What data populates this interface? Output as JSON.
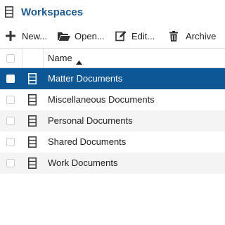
{
  "header": {
    "title": "Workspaces",
    "icon": "cabinet-icon"
  },
  "toolbar": {
    "new_label": "New...",
    "open_label": "Open...",
    "edit_label": "Edit...",
    "archive_label": "Archive"
  },
  "grid": {
    "column_name": "Name",
    "sort": "ascending",
    "rows": [
      {
        "name": "Matter Documents",
        "selected": true
      },
      {
        "name": "Miscellaneous Documents",
        "selected": false
      },
      {
        "name": "Personal Documents",
        "selected": false
      },
      {
        "name": "Shared Documents",
        "selected": false
      },
      {
        "name": "Work Documents",
        "selected": false
      }
    ]
  },
  "colors": {
    "accent": "#1f5a8f",
    "selection": "#0e5796",
    "alt_row": "#f4f4f4"
  }
}
